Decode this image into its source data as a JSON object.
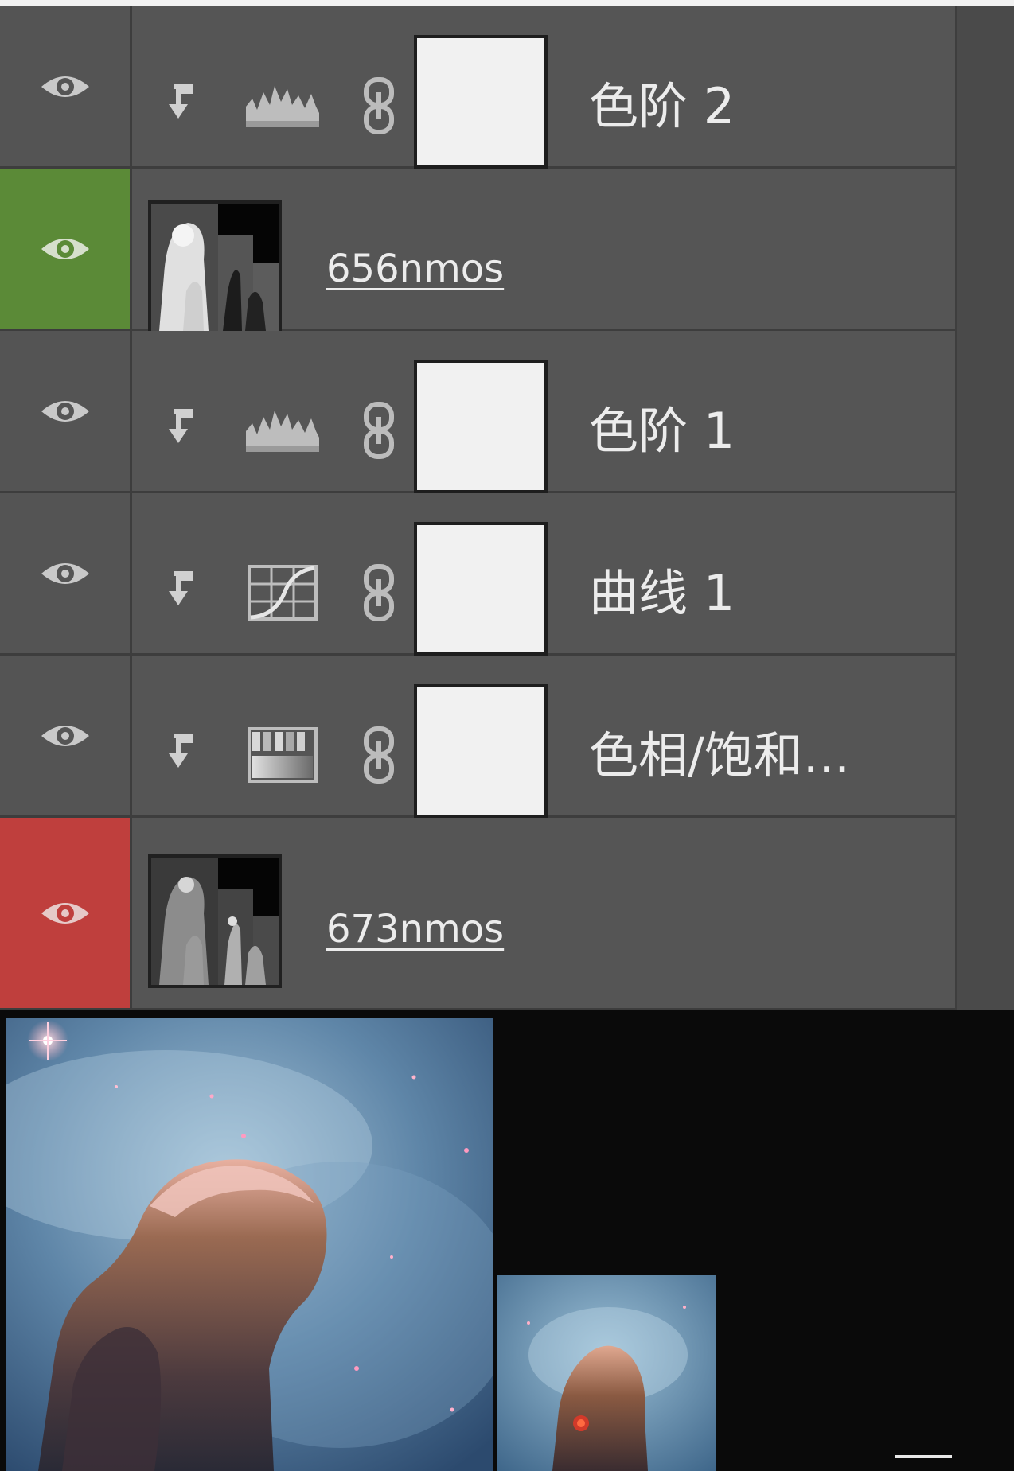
{
  "layers_panel": {
    "layers": [
      {
        "name": "色阶 2",
        "kind": "adjustment",
        "adjustment_icon": "levels-icon",
        "clipped": true,
        "label_color": "none"
      },
      {
        "name": "656nmos",
        "kind": "image",
        "clipped": false,
        "label_color": "green"
      },
      {
        "name": "色阶 1",
        "kind": "adjustment",
        "adjustment_icon": "levels-icon",
        "clipped": true,
        "label_color": "none"
      },
      {
        "name": "曲线 1",
        "kind": "adjustment",
        "adjustment_icon": "curves-icon",
        "clipped": true,
        "label_color": "none"
      },
      {
        "name": "色相/饱和...",
        "kind": "adjustment",
        "adjustment_icon": "hue-saturation-icon",
        "clipped": true,
        "label_color": "none"
      },
      {
        "name": "673nmos",
        "kind": "image",
        "clipped": false,
        "label_color": "red"
      }
    ]
  },
  "colors": {
    "panel_bg": "#535353",
    "label_green": "#5b8a37",
    "label_red": "#bf3f3d",
    "mask_white": "#f1f1f1"
  },
  "icons": {
    "visibility": "eye-icon",
    "clip": "clipping-arrow-icon",
    "link": "chain-link-icon"
  }
}
